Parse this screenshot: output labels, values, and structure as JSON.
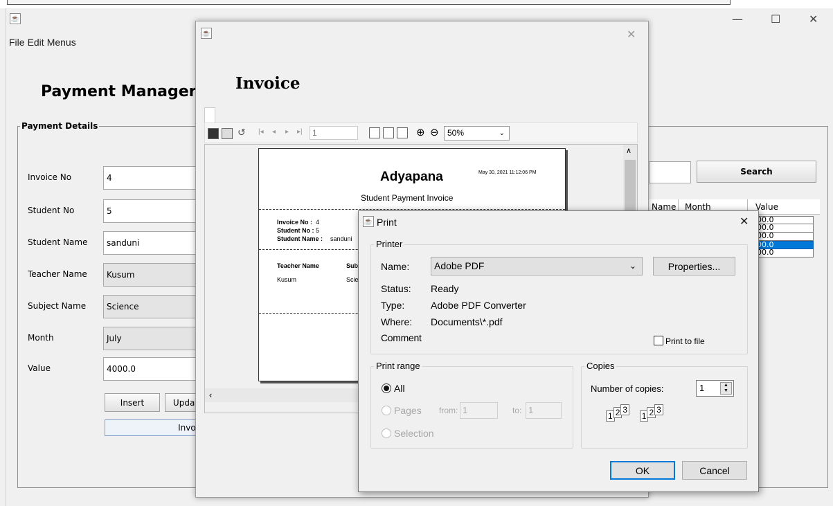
{
  "main_window": {
    "menu": [
      "File",
      "Edit",
      "Menus"
    ],
    "title": "Payment Manager",
    "group_title": "Payment Details",
    "fields": [
      {
        "label": "Invoice No",
        "value": "4",
        "readonly": false
      },
      {
        "label": "Student No",
        "value": "5",
        "readonly": false
      },
      {
        "label": "Student Name",
        "value": "sanduni",
        "readonly": false
      },
      {
        "label": "Teacher Name",
        "value": "Kusum",
        "readonly": true
      },
      {
        "label": "Subject Name",
        "value": "Science",
        "readonly": true
      },
      {
        "label": "Month",
        "value": "July",
        "readonly": true
      },
      {
        "label": "Value",
        "value": "4000.0",
        "readonly": false
      }
    ],
    "insert_label": "Insert",
    "update_label": "Updat",
    "invoice_label": "Invoi",
    "search_label": "Search",
    "table": {
      "headers": [
        "Name",
        "Month",
        "Value"
      ],
      "rows": [
        "00.0",
        "00.0",
        "00.0",
        "00.0",
        "00.0"
      ],
      "selected_row": 3
    }
  },
  "invoice_window": {
    "title": "Invoice",
    "page_number": "1",
    "zoom": "50%",
    "report": {
      "company": "Adyapana",
      "date": "May 30, 2021 11:12:06 PM",
      "subtitle": "Student Payment Invoice",
      "invoice_no_label": "Invoice No :",
      "invoice_no": "4",
      "student_no_label": "Student No :",
      "student_no": "5",
      "student_name_label": "Student Name :",
      "student_name": "sanduni",
      "teacher_header": "Teacher Name",
      "subject_header": "Sub",
      "teacher_value": "Kusum",
      "subject_value": "Scie"
    }
  },
  "print_dialog": {
    "title": "Print",
    "printer_group": "Printer",
    "name_label": "Name:",
    "name_value": "Adobe PDF",
    "properties_label": "Properties...",
    "status_label": "Status:",
    "status_value": "Ready",
    "type_label": "Type:",
    "type_value": "Adobe PDF Converter",
    "where_label": "Where:",
    "where_value": "Documents\\*.pdf",
    "comment_label": "Comment",
    "print_to_file_label": "Print to file",
    "range_group": "Print range",
    "all_label": "All",
    "pages_label": "Pages",
    "from_label": "from:",
    "from_value": "1",
    "to_label": "to:",
    "to_value": "1",
    "selection_label": "Selection",
    "copies_group": "Copies",
    "copies_label": "Number of copies:",
    "copies_value": "1",
    "ok_label": "OK",
    "cancel_label": "Cancel"
  }
}
